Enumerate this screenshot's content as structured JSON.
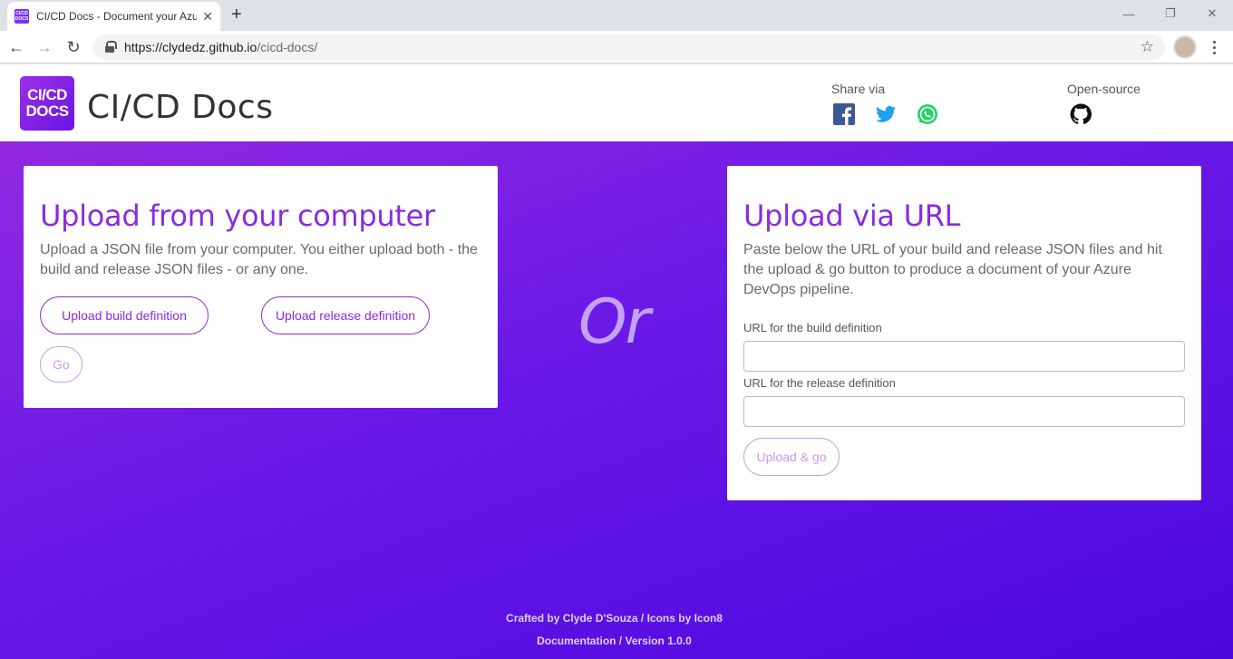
{
  "browser": {
    "tab_title": "CI/CD Docs - Document your Azure",
    "new_tab_label": "+",
    "url_host": "https://clydedz.github.io",
    "url_path": "/cicd-docs/",
    "window_controls": {
      "minimize": "—",
      "restore": "❐",
      "close": "✕"
    }
  },
  "header": {
    "logo_line1": "CI/CD",
    "logo_line2": "DOCS",
    "title": "CI/CD Docs",
    "share_label": "Share via",
    "share_icons": [
      "facebook-icon",
      "twitter-icon",
      "whatsapp-icon"
    ],
    "opensource_label": "Open-source",
    "opensource_icon": "github-icon"
  },
  "left_card": {
    "heading": "Upload from your computer",
    "description": "Upload a JSON file from your computer. You either upload both - the build and release JSON files - or any one.",
    "build_button": "Upload build definition",
    "release_button": "Upload release definition",
    "go_button": "Go"
  },
  "divider_text": "Or",
  "right_card": {
    "heading": "Upload via URL",
    "description": "Paste below the URL of your build and release JSON files and hit the upload & go button to produce a document of your Azure DevOps pipeline.",
    "build_url_label": "URL for the build definition",
    "build_url_value": "",
    "release_url_label": "URL for the release definition",
    "release_url_value": "",
    "upload_button": "Upload & go"
  },
  "footer": {
    "line1": "Crafted by Clyde D'Souza / Icons by Icon8",
    "line2": "Documentation / Version 1.0.0"
  },
  "colors": {
    "accent": "#8a2be2",
    "hero_start": "#9229e2",
    "hero_end": "#4d08df",
    "facebook": "#3b5998",
    "twitter": "#1da1f2",
    "whatsapp": "#25d366"
  }
}
